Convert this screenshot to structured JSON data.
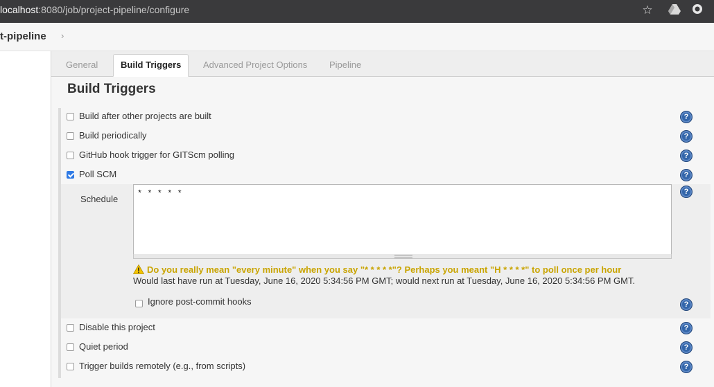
{
  "browser": {
    "url_host": "localhost",
    "url_path": ":8080/job/project-pipeline/configure",
    "icons": [
      "star-icon",
      "drive-icon",
      "extension-icon"
    ]
  },
  "breadcrumb": {
    "job": "t-pipeline",
    "chevron": "›"
  },
  "tabs": [
    {
      "label": "General",
      "active": false
    },
    {
      "label": "Build Triggers",
      "active": true
    },
    {
      "label": "Advanced Project Options",
      "active": false
    },
    {
      "label": "Pipeline",
      "active": false
    }
  ],
  "section_title": "Build Triggers",
  "triggers": [
    {
      "label": "Build after other projects are built",
      "checked": false
    },
    {
      "label": "Build periodically",
      "checked": false
    },
    {
      "label": "GitHub hook trigger for GITScm polling",
      "checked": false
    },
    {
      "label": "Poll SCM",
      "checked": true
    }
  ],
  "poll_scm": {
    "schedule_label": "Schedule",
    "schedule_value": "* * * * *",
    "warning": "Do you really mean \"every minute\" when you say \"* * * * *\"? Perhaps you meant \"H * * * *\" to poll once per hour",
    "info": "Would last have run at Tuesday, June 16, 2020 5:34:56 PM GMT; would next run at Tuesday, June 16, 2020 5:34:56 PM GMT.",
    "ignore_label": "Ignore post-commit hooks",
    "ignore_checked": false
  },
  "more_options": [
    {
      "label": "Disable this project",
      "checked": false
    },
    {
      "label": "Quiet period",
      "checked": false
    },
    {
      "label": "Trigger builds remotely (e.g., from scripts)",
      "checked": false
    }
  ],
  "help_glyph": "?",
  "colors": {
    "help_blue": "#3366aa",
    "checkbox_checked": "#2f7ae5",
    "warning_text": "#c9a400"
  }
}
